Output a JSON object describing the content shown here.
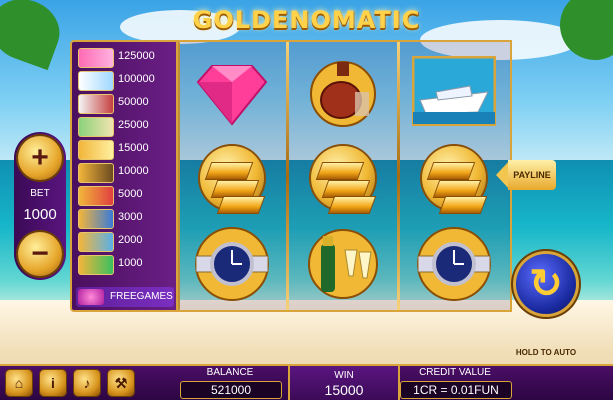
{
  "game": {
    "title": "GOLDENOMATIC"
  },
  "paytable": {
    "rows": [
      {
        "value": "125000"
      },
      {
        "value": "100000"
      },
      {
        "value": "50000"
      },
      {
        "value": "25000"
      },
      {
        "value": "15000"
      },
      {
        "value": "10000"
      },
      {
        "value": "5000"
      },
      {
        "value": "3000"
      },
      {
        "value": "2000"
      },
      {
        "value": "1000"
      }
    ],
    "freegames_label": "FREEGAMES"
  },
  "reels": {
    "symbols": [
      [
        "diamond",
        "gold-bars",
        "watch"
      ],
      [
        "cognac",
        "gold-bars",
        "champagne"
      ],
      [
        "yacht",
        "gold-bars",
        "watch"
      ]
    ]
  },
  "payline": {
    "label": "PAYLINE"
  },
  "bet": {
    "label": "BET",
    "value": "1000",
    "plus": "+",
    "minus": "−"
  },
  "spin": {
    "hold_label": "HOLD TO AUTO"
  },
  "status": {
    "balance_label": "BALANCE",
    "balance_value": "521000",
    "win_label": "WIN",
    "win_value": "15000",
    "credit_label": "CREDIT VALUE",
    "credit_value": "1CR = 0.01FUN"
  },
  "menu": {
    "icons": [
      "home-icon",
      "info-icon",
      "sound-icon",
      "settings-icon"
    ]
  },
  "colors": {
    "gold": "#d9a43a",
    "purple": "#4b0e66",
    "spin_blue": "#1a2aa0"
  }
}
